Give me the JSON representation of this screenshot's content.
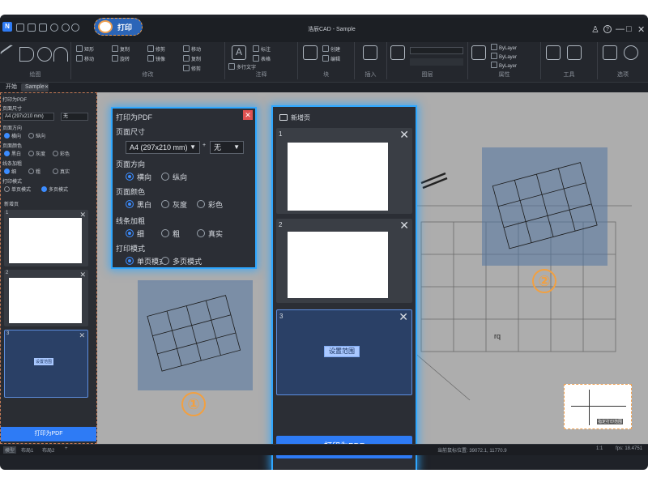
{
  "titlebar": {
    "title": "浩辰CAD - Sample",
    "print_badge": "打印",
    "min": "—",
    "max": "□",
    "close": "✕",
    "user": "♙",
    "help": "?"
  },
  "ribbon": {
    "groups": [
      {
        "label": "绘图"
      },
      {
        "label": "修改"
      },
      {
        "label": "注释"
      },
      {
        "label": "块"
      },
      {
        "label": "插入"
      },
      {
        "label": "图层"
      },
      {
        "label": "属性"
      },
      {
        "label": "工具"
      },
      {
        "label": "选项"
      }
    ],
    "items": [
      "直线",
      "多段线",
      "圆",
      "圆弧",
      "矩形",
      "移动",
      "复制",
      "旋转",
      "修剪",
      "镜像",
      "多行文字",
      "标注",
      "表格",
      "插入",
      "创建",
      "编辑",
      "ByLayer",
      "ByLayer",
      "ByLayer",
      "匹配",
      "测量",
      "剪贴板"
    ]
  },
  "tabs": {
    "start": "开始",
    "sample": "Sample",
    "close": "✕"
  },
  "left_panel": {
    "title": "打印为PDF",
    "page_size_label": "页面尺寸",
    "page_size_value": "A4 (297x210 mm)",
    "extra_value": "无",
    "orientation_label": "页面方向",
    "orientation_options": [
      "横向",
      "纵向"
    ],
    "color_label": "页面颜色",
    "color_options": [
      "黑白",
      "灰度",
      "彩色"
    ],
    "line_label": "线条加粗",
    "line_options": [
      "细",
      "粗",
      "真实"
    ],
    "mode_label": "打印模式",
    "mode_options": [
      "单页模式",
      "多页模式"
    ],
    "new_page": "新增页",
    "cards": [
      "1",
      "2",
      "3"
    ],
    "set_range": "设置范围",
    "print_button": "打印为PDF"
  },
  "settings_panel": {
    "title": "打印为PDF",
    "page_size_label": "页面尺寸",
    "page_size_value": "A4 (297x210 mm)",
    "extra_value": "无",
    "orientation_label": "页面方向",
    "orientation_options": [
      "横向",
      "纵向"
    ],
    "color_label": "页面颜色",
    "color_options": [
      "黑白",
      "灰度",
      "彩色"
    ],
    "line_label": "线条加粗",
    "line_options": [
      "细",
      "粗",
      "真实"
    ],
    "mode_label": "打印模式",
    "mode_options": [
      "单页模式",
      "多页模式"
    ]
  },
  "pages_panel": {
    "new_page": "新增页",
    "cards": [
      "1",
      "2",
      "3"
    ],
    "set_range": "设置范围",
    "print_button": "打印为PDF"
  },
  "canvas": {
    "marker_1": "①",
    "marker_2": "②",
    "rq_text": "rq",
    "corner_label": "指定打印范围"
  },
  "statusbar": {
    "tabs": [
      "模型",
      "布局1",
      "布局2",
      "+"
    ],
    "coords": "当前鼠标位置: 39072.1, 11770.9",
    "scale": "1:1",
    "fps": "fps: 18.4751"
  },
  "colors": {
    "accent": "#2e7bf5",
    "glow": "#2fa7ff",
    "marker": "#f2a040",
    "close_red": "#e05252"
  }
}
